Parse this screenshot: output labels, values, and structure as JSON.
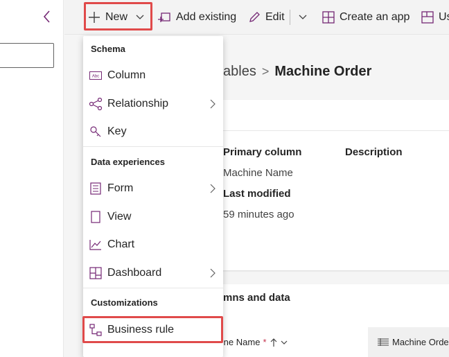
{
  "colors": {
    "accent": "#742774",
    "highlight": "#e04a4a",
    "text": "#242424"
  },
  "toolbar": {
    "new_label": "New",
    "add_existing_label": "Add existing",
    "edit_label": "Edit",
    "create_app_label": "Create an app",
    "cut_label": "Us"
  },
  "breadcrumb": {
    "parent": "ables",
    "separator": ">",
    "current": "Machine Order"
  },
  "properties": {
    "primary_column_label": "Primary column",
    "primary_column_value": "Machine Name",
    "description_label": "Description",
    "last_modified_label": "Last modified",
    "last_modified_value": "59 minutes ago"
  },
  "columns_section": {
    "title": "mns and data",
    "col1_label": "Machine Name",
    "col1_required": "*",
    "col2_label": "Machine Orde"
  },
  "menu": {
    "group_schema": "Schema",
    "column": "Column",
    "relationship": "Relationship",
    "key": "Key",
    "group_data_experiences": "Data experiences",
    "form": "Form",
    "view": "View",
    "chart": "Chart",
    "dashboard": "Dashboard",
    "group_customizations": "Customizations",
    "business_rule": "Business rule"
  }
}
